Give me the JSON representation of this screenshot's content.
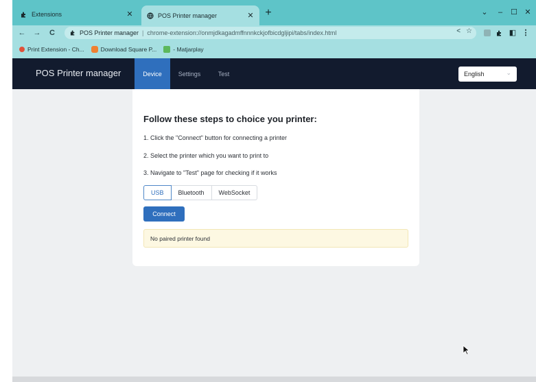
{
  "browser": {
    "tabs": [
      {
        "title": "Extensions",
        "icon": "puzzle-icon",
        "active": false
      },
      {
        "title": "POS Printer manager",
        "icon": "globe-icon",
        "active": true
      }
    ],
    "address": {
      "site_name": "POS Printer manager",
      "separator": "|",
      "url": "chrome-extension://onmjdkagadmffnnnkckjofbicdgljipi/tabs/index.html"
    },
    "bookmarks": [
      {
        "label": "Print Extension - Ch...",
        "icon_color": "#e0523a"
      },
      {
        "label": "Download Square P...",
        "icon_color": "#f08030"
      },
      {
        "label": "- Matjarplay",
        "icon_color": "#5cb85c"
      }
    ]
  },
  "app": {
    "brand": "POS Printer manager",
    "nav": [
      {
        "label": "Device",
        "active": true
      },
      {
        "label": "Settings",
        "active": false
      },
      {
        "label": "Test",
        "active": false
      }
    ],
    "language": "English"
  },
  "card": {
    "title": "Follow these steps to choice you printer:",
    "steps": [
      "1. Click the \"Connect\" button for connecting a printer",
      "2. Select the printer which you want to print to",
      "3. Navigate to \"Test\" page for checking if it works"
    ],
    "connection_types": [
      {
        "label": "USB",
        "active": true
      },
      {
        "label": "Bluetooth",
        "active": false
      },
      {
        "label": "WebSocket",
        "active": false
      }
    ],
    "connect_label": "Connect",
    "alert": "No paired printer found"
  },
  "colors": {
    "tabstrip": "#5ec4c8",
    "toolbar": "#a5dfe1",
    "navbar": "#121b2e",
    "primary": "#2f6fbd",
    "alert_bg": "#fdf8e2"
  }
}
